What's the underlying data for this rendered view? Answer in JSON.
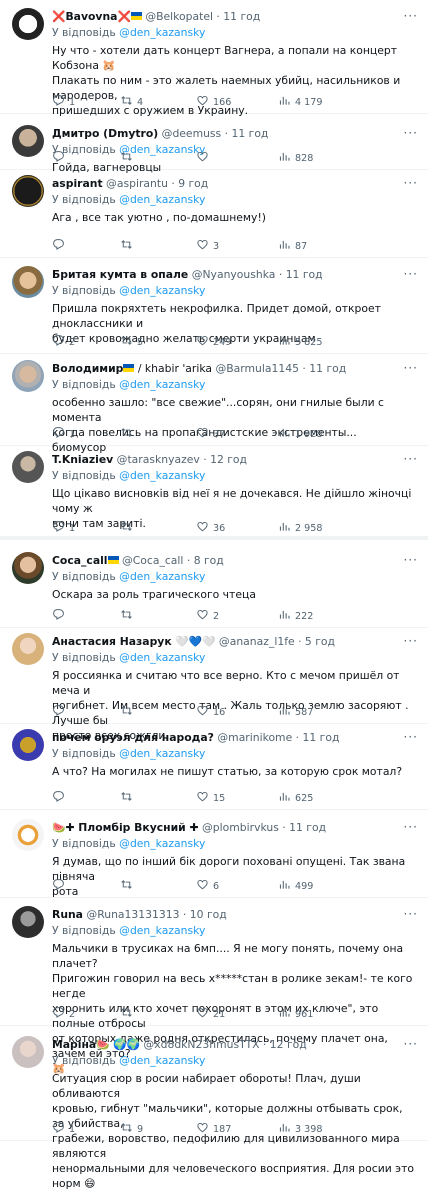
{
  "tweets": [
    {
      "name": "Bavovna",
      "handle": "@Belkopatel · 11 год",
      "reply_prefix": "У відповідь",
      "reply_mention": "@den_kazansky",
      "lines": [
        "Ну что - хотели дать концерт Вагнера, а попали на концерт Кобзона 🐹",
        "Плакать по ним - это жалеть наемных убийц, насильников и мародеров,",
        "пришедших с оружием в Украину."
      ],
      "reply_count": "1",
      "retweets": "4",
      "likes": "166",
      "views": "4 179"
    },
    {
      "name": "Дмитро (Dmytro)",
      "handle": "@deemuss · 11 год",
      "reply_prefix": "У відповідь",
      "reply_mention": "@den_kazansky",
      "lines": [
        "Гойда, вагнеровцы"
      ],
      "reply_count": "",
      "retweets": "",
      "likes": "",
      "views": "828"
    },
    {
      "name": "aspirant",
      "handle": "@aspirantu · 9 год",
      "reply_prefix": "У відповідь",
      "reply_mention": "@den_kazansky",
      "lines": [
        "Ага , все так уютно , по-домашнему!)"
      ],
      "reply_count": "",
      "retweets": "",
      "likes": "3",
      "views": "87"
    },
    {
      "name": "Бритая кумта в опале",
      "handle": "@Nyanyoushka · 11 год",
      "reply_prefix": "У відповідь",
      "reply_mention": "@den_kazansky",
      "lines": [
        "Пришла покряхтеть некрофилка. Придет домой, откроет дноклассники и",
        "будет кровожадно желать смерти украинцам"
      ],
      "reply_count": "2",
      "retweets": "5",
      "likes": "249",
      "views": "5 825"
    },
    {
      "name": "Володимир",
      "name2": " / khabir 'arika",
      "handle": "@Barmula1145 · 11 год",
      "reply_prefix": "У відповідь",
      "reply_mention": "@den_kazansky",
      "lines": [
        "особенно зашло: \"все свежие\"...сорян, они гнилые были с момента",
        "когда повелись на пропагандистские экстременты... биомусор"
      ],
      "reply_count": "1",
      "retweets": "",
      "likes": "37",
      "views": "1 928"
    },
    {
      "name": "T.Kniaziev",
      "handle": "@tarasknyazev · 12 год",
      "reply_prefix": "У відповідь",
      "reply_mention": "@den_kazansky",
      "lines": [
        "Що цікаво висновків від неї я не дочекався. Не дійшло жіночці чому ж",
        "вони там зариті."
      ],
      "reply_count": "1",
      "retweets": "",
      "likes": "36",
      "views": "2 958"
    },
    {
      "name": "Coca_call",
      "handle": "@Coca_call · 8 год",
      "reply_prefix": "У відповідь",
      "reply_mention": "@den_kazansky",
      "lines": [
        "Оскара за роль трагического чтеца"
      ],
      "reply_count": "",
      "retweets": "",
      "likes": "2",
      "views": "222"
    },
    {
      "name": "Анастасия Назарук",
      "handle": "@ananaz_l1fe · 5 год",
      "reply_prefix": "У відповідь",
      "reply_mention": "@den_kazansky",
      "lines": [
        "Я россиянка и считаю что все верно. Кто с мечом пришёл от меча и",
        "погибнет. Им всем место там . Жаль только землю засоряют . Лучше бы",
        "просто всех сожгли."
      ],
      "reply_count": "",
      "retweets": "",
      "likes": "16",
      "views": "587"
    },
    {
      "name": "почем оруэл для народа?",
      "handle": "@marinikome · 11 год",
      "reply_prefix": "У відповідь",
      "reply_mention": "@den_kazansky",
      "lines": [
        "А что? На могилах не пишут статью, за которую срок мотал?"
      ],
      "reply_count": "",
      "retweets": "",
      "likes": "15",
      "views": "625"
    },
    {
      "name": "🍉✚ Пломбір Вкусний ✚",
      "handle": "@plombirvkus · 11 год",
      "reply_prefix": "У відповідь",
      "reply_mention": "@den_kazansky",
      "lines": [
        "Я думав, що по інший бік дороги поховані опущені. Так звана півнячa",
        "рота"
      ],
      "reply_count": "",
      "retweets": "",
      "likes": "6",
      "views": "499"
    },
    {
      "name": "Runa",
      "handle": "@Runa13131313 · 10 год",
      "reply_prefix": "У відповідь",
      "reply_mention": "@den_kazansky",
      "lines": [
        "Мальчики в трусиках на 6мп.... Я не могу понять, почему она плачет?",
        "Пригожин говорил на весь х*****стан в ролике зекам!- те кого негде",
        "хоронить или кто хочет похоронят в этом их ключе\", это полные отбросы",
        "от которых даже родня открестилась, почему плачет она, зачем ей это?",
        "🐹"
      ],
      "reply_count": "2",
      "retweets": "",
      "likes": "21",
      "views": "961"
    },
    {
      "name": "Маріна",
      "handle": "@xd8dkN23hmusTTX · 12 год",
      "reply_prefix": "У відповідь",
      "reply_mention": "@den_kazansky",
      "lines": [
        "Ситуация сюр в росии набирает обороты! Плач, души обливаются",
        "кровью, гибнут \"мальчики\", которые должны отбывать срок, за убийства,",
        "грабежи, воровство, педофилию для цивилизованного мира являются",
        "ненормальными для человеческого восприятия. Для росии это норм 😄"
      ],
      "reply_count": "1",
      "retweets": "9",
      "likes": "187",
      "views": "3 398"
    }
  ],
  "icons": {
    "reply": "comment-icon",
    "retweet": "retweet-icon",
    "like": "heart-icon",
    "views": "views-icon",
    "more": "more-icon"
  },
  "colors": {
    "link": "#1d9bf0",
    "muted": "#536471",
    "text": "#0f1419"
  }
}
